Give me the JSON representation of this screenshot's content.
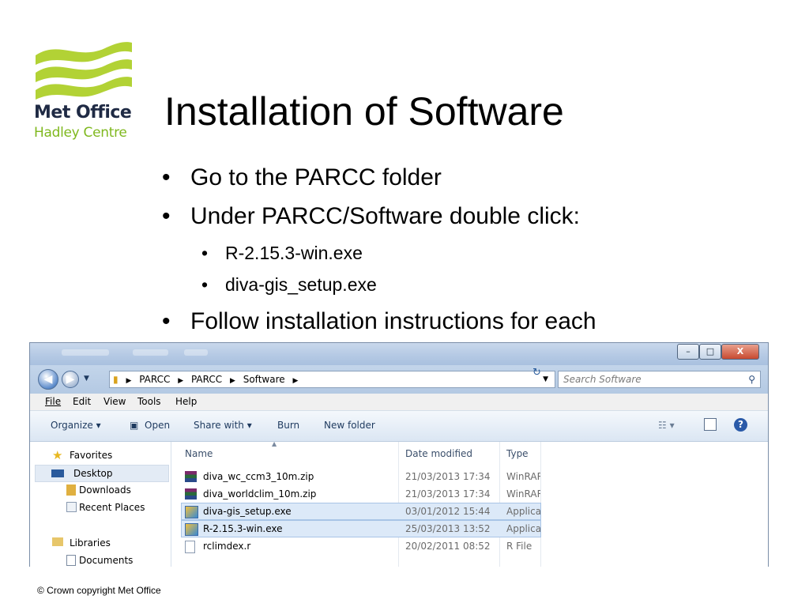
{
  "logo": {
    "line1": "Met Office",
    "line2": "Hadley Centre"
  },
  "title": "Installation of Software",
  "bullets": [
    "Go to the PARCC folder",
    "Under PARCC/Software double click:",
    "Follow installation instructions for each"
  ],
  "sub_bullets": [
    "R-2.15.3-win.exe",
    "diva-gis_setup.exe"
  ],
  "explorer": {
    "window_buttons": {
      "minimize": "–",
      "maximize": "□",
      "close": "X"
    },
    "breadcrumb": [
      "PARCC",
      "PARCC",
      "Software"
    ],
    "search_placeholder": "Search Software",
    "menu": [
      "File",
      "Edit",
      "View",
      "Tools",
      "Help"
    ],
    "toolbar": {
      "organize": "Organize ▾",
      "open": "Open",
      "share": "Share with ▾",
      "burn": "Burn",
      "new_folder": "New folder"
    },
    "nav": {
      "favorites": "Favorites",
      "desktop": "Desktop",
      "downloads": "Downloads",
      "recent": "Recent Places",
      "libraries": "Libraries",
      "documents": "Documents"
    },
    "columns": {
      "name": "Name",
      "date": "Date modified",
      "type": "Type"
    },
    "files": [
      {
        "name": "diva_wc_ccm3_10m.zip",
        "date": "21/03/2013 17:34",
        "type": "WinRAR"
      },
      {
        "name": "diva_worldclim_10m.zip",
        "date": "21/03/2013 17:34",
        "type": "WinRAR"
      },
      {
        "name": "diva-gis_setup.exe",
        "date": "03/01/2012 15:44",
        "type": "Application"
      },
      {
        "name": "R-2.15.3-win.exe",
        "date": "25/03/2013 13:52",
        "type": "Application"
      },
      {
        "name": "rclimdex.r",
        "date": "20/02/2011 08:52",
        "type": "R File"
      }
    ]
  },
  "copyright": "© Crown copyright   Met Office",
  "colors": {
    "logo_green": "#b2d235",
    "logo_navy": "#1f2a44",
    "selection": "#dce9f8"
  }
}
